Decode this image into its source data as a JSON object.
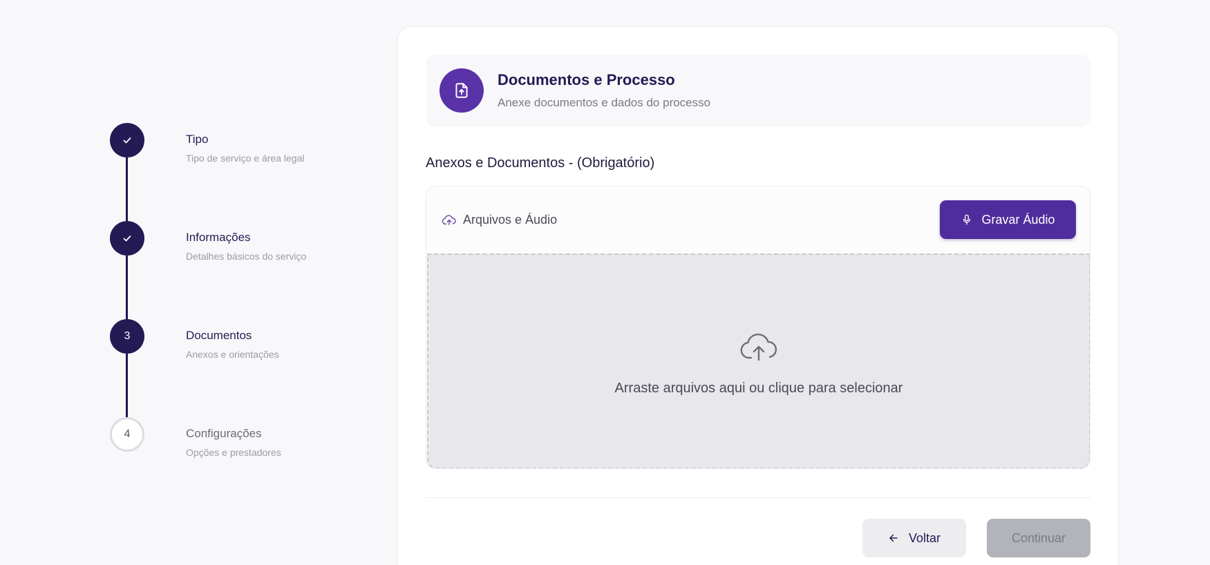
{
  "stepper": {
    "steps": [
      {
        "marker": "",
        "status": "done",
        "title": "Tipo",
        "subtitle": "Tipo de serviço e área legal"
      },
      {
        "marker": "",
        "status": "done",
        "title": "Informações",
        "subtitle": "Detalhes básicos do serviço"
      },
      {
        "marker": "3",
        "status": "current",
        "title": "Documentos",
        "subtitle": "Anexos e orientações"
      },
      {
        "marker": "4",
        "status": "todo",
        "title": "Configurações",
        "subtitle": "Opções e prestadores"
      }
    ]
  },
  "header": {
    "icon": "file-upload-icon",
    "title": "Documentos e Processo",
    "subtitle": "Anexe documentos e dados do processo"
  },
  "attachments": {
    "section_label": "Anexos e Documentos - (Obrigatório)",
    "toolbar_icon": "cloud-upload-icon",
    "toolbar_label": "Arquivos e Áudio",
    "record_icon": "microphone-icon",
    "record_label": "Gravar Áudio",
    "dropzone_icon": "cloud-upload-icon",
    "dropzone_text": "Arraste arquivos aqui ou clique para selecionar"
  },
  "footer": {
    "back_icon": "arrow-left-icon",
    "back_label": "Voltar",
    "continue_label": "Continuar",
    "continue_disabled": true
  },
  "colors": {
    "primary": "#241a54",
    "accent": "#5a32a8",
    "button": "#4f2d9c",
    "disabled": "#b3b3bc",
    "background": "#f8f8fa"
  }
}
